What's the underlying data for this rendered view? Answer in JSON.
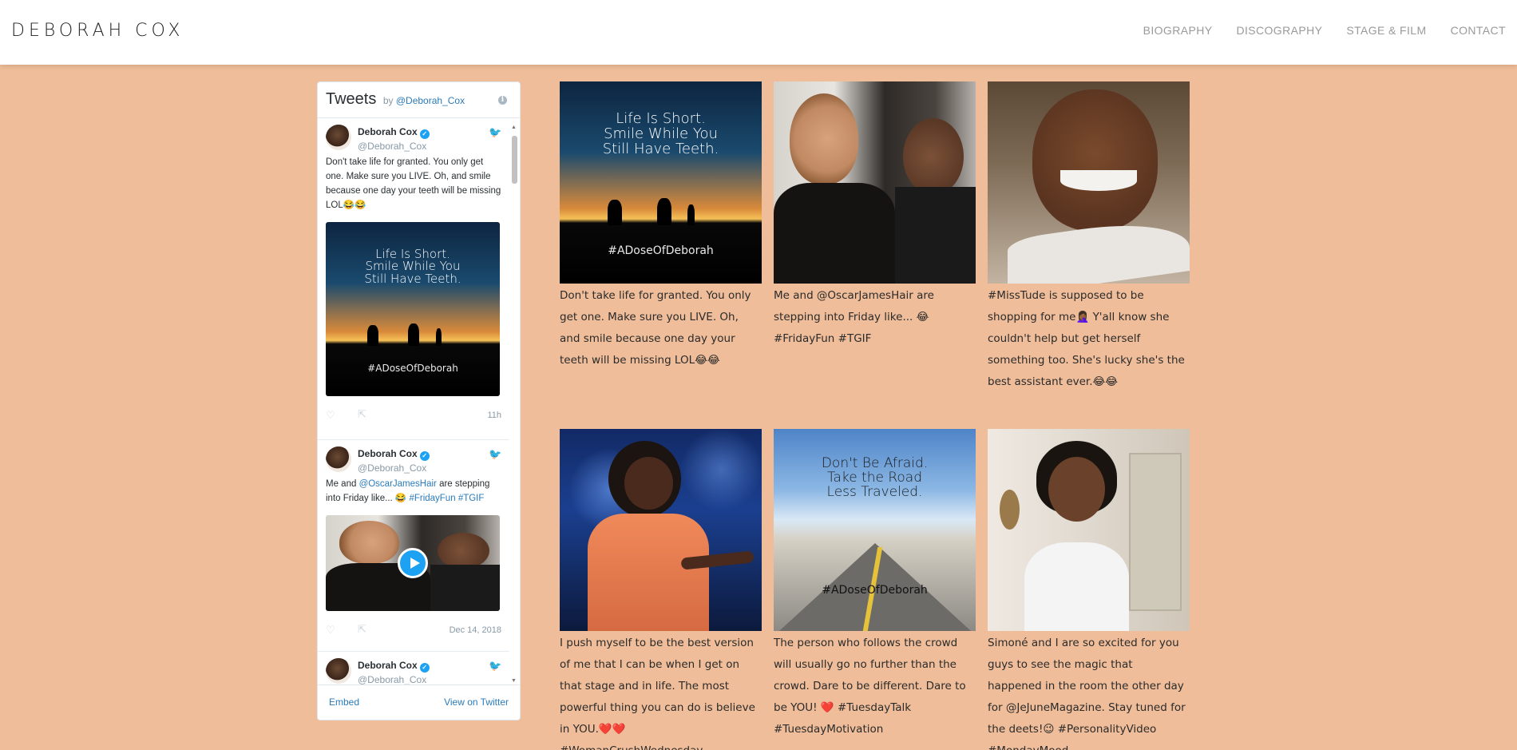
{
  "header": {
    "title": "DEBORAH COX",
    "nav": [
      "BIOGRAPHY",
      "DISCOGRAPHY",
      "STAGE & FILM",
      "CONTACT"
    ]
  },
  "widget": {
    "title": "Tweets",
    "by": "by",
    "handle": "@Deborah_Cox",
    "footer": {
      "embed": "Embed",
      "view": "View on Twitter"
    },
    "tweets": [
      {
        "name": "Deborah Cox",
        "handle": "@Deborah_Cox",
        "text": "Don't take life for granted. You only get one. Make sure you LIVE. Oh, and smile because one day your teeth will be missing LOL😂😂",
        "media_line1": "Life Is Short.",
        "media_line2": "Smile While You",
        "media_line3": "Still Have Teeth.",
        "media_tag": "#ADoseOfDeborah",
        "time": "11h"
      },
      {
        "name": "Deborah Cox",
        "handle": "@Deborah_Cox",
        "text_a": "Me and ",
        "mention": "@OscarJamesHair",
        "text_b": " are stepping into Friday like... 😂 ",
        "hashtag1": "#FridayFun",
        "hashtag2": "#TGIF",
        "time": "Dec 14, 2018"
      },
      {
        "name": "Deborah Cox",
        "handle": "@Deborah_Cox"
      }
    ]
  },
  "grid": [
    {
      "caption": "Don't take life for granted. You only get one. Make sure you LIVE. Oh, and smile because one day your teeth will be missing LOL😂😂",
      "img_line1": "Life Is Short.",
      "img_line2": "Smile While You",
      "img_line3": "Still Have Teeth.",
      "img_tag": "#ADoseOfDeborah"
    },
    {
      "caption": "Me and @OscarJamesHair are stepping into Friday like... 😂 #FridayFun #TGIF"
    },
    {
      "caption": "#MissTude is supposed to be shopping for me🤦🏾‍♀️ Y'all know she couldn't help but get herself something too. She's lucky she's the best assistant ever.😂😂"
    },
    {
      "caption": "I push myself to be the best version of me that I can be when I get on that stage and in life. The most powerful thing you can do is believe in YOU.❤️❤️ #WomanCrushWednesday #SelfAppreciationPost"
    },
    {
      "caption": "The person who follows the crowd will usually go no further than the crowd. Dare to be different. Dare to be YOU! ❤️ #TuesdayTalk #TuesdayMotivation",
      "img_line1": "Don't Be Afraid.",
      "img_line2": "Take the Road",
      "img_line3": "Less Traveled.",
      "img_tag": "#ADoseOfDeborah"
    },
    {
      "caption": "Simoné and I are so excited for you guys to see the magic that happened in the room the other day for @JeJuneMagazine. Stay tuned for the deets!😉 #PersonalityVideo #MondayMood"
    }
  ],
  "colors": {
    "background": "#EFBD99",
    "twitter_blue": "#1DA1F2",
    "link": "#2B7BB9"
  },
  "icons": [
    "info-icon",
    "bird-icon",
    "verified-icon",
    "heart-icon",
    "share-icon",
    "play-icon"
  ]
}
